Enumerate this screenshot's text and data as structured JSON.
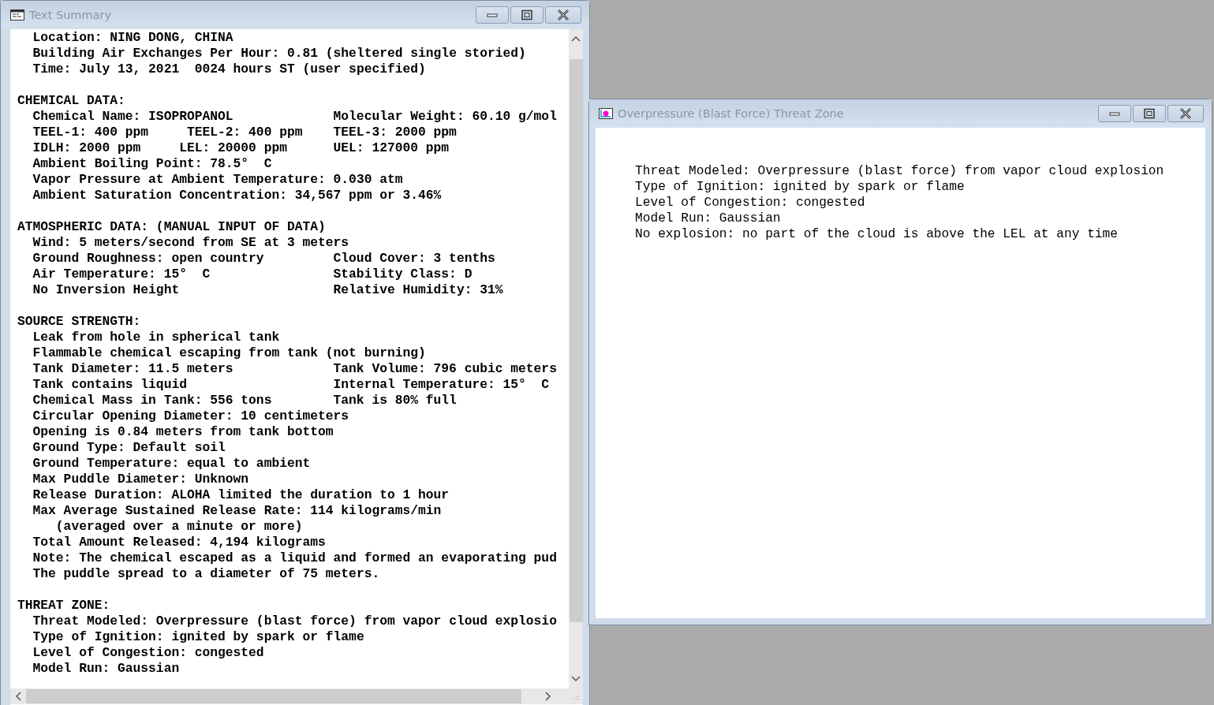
{
  "windows": [
    {
      "kind": "text_summary",
      "title": "Text Summary",
      "sections": [
        {
          "lines": [
            {
              "kind": "item",
              "text": "Location: NING DONG, CHINA"
            },
            {
              "kind": "item",
              "text": "Building Air Exchanges Per Hour: 0.81 (sheltered single storied)"
            },
            {
              "kind": "item",
              "text": "Time: July 13, 2021  0024 hours ST (user specified)"
            }
          ]
        },
        {
          "heading": "CHEMICAL DATA:",
          "lines": [
            {
              "kind": "item",
              "text": "Chemical Name: ISOPROPANOL",
              "column_2": "Molecular Weight: 60.10 g/mol"
            },
            {
              "kind": "item",
              "text": "TEEL-1: 400 ppm     TEEL-2: 400 ppm",
              "column_2": "TEEL-3: 2000 ppm"
            },
            {
              "kind": "item",
              "text": "IDLH: 2000 ppm     LEL: 20000 ppm",
              "column_2": "UEL: 127000 ppm"
            },
            {
              "kind": "item",
              "text": "Ambient Boiling Point: 78.5°  C"
            },
            {
              "kind": "item",
              "text": "Vapor Pressure at Ambient Temperature: 0.030 atm"
            },
            {
              "kind": "item",
              "text": "Ambient Saturation Concentration: 34,567 ppm or 3.46%"
            }
          ]
        },
        {
          "heading": "ATMOSPHERIC DATA: (MANUAL INPUT OF DATA)",
          "lines": [
            {
              "kind": "item",
              "text": "Wind: 5 meters/second from SE at 3 meters"
            },
            {
              "kind": "item",
              "text": "Ground Roughness: open country",
              "column_2": "Cloud Cover: 3 tenths"
            },
            {
              "kind": "item",
              "text": "Air Temperature: 15°  C",
              "column_2": "Stability Class: D"
            },
            {
              "kind": "item",
              "text": "No Inversion Height",
              "column_2": "Relative Humidity: 31%"
            }
          ]
        },
        {
          "heading": "SOURCE STRENGTH:",
          "lines": [
            {
              "kind": "item",
              "text": "Leak from hole in spherical tank"
            },
            {
              "kind": "item",
              "text": "Flammable chemical escaping from tank (not burning)"
            },
            {
              "kind": "item",
              "text": "Tank Diameter: 11.5 meters",
              "column_2": "Tank Volume: 796 cubic meters"
            },
            {
              "kind": "item",
              "text": "Tank contains liquid",
              "column_2": "Internal Temperature: 15°  C"
            },
            {
              "kind": "item",
              "text": "Chemical Mass in Tank: 556 tons",
              "column_2": "Tank is 80% full"
            },
            {
              "kind": "item",
              "text": "Circular Opening Diameter: 10 centimeters"
            },
            {
              "kind": "item",
              "text": "Opening is 0.84 meters from tank bottom"
            },
            {
              "kind": "item",
              "text": "Ground Type: Default soil"
            },
            {
              "kind": "item",
              "text": "Ground Temperature: equal to ambient"
            },
            {
              "kind": "item",
              "text": "Max Puddle Diameter: Unknown"
            },
            {
              "kind": "item",
              "text": "Release Duration: ALOHA limited the duration to 1 hour"
            },
            {
              "kind": "item",
              "text": "Max Average Sustained Release Rate: 114 kilograms/min"
            },
            {
              "kind": "continuation",
              "text": "(averaged over a minute or more)"
            },
            {
              "kind": "item",
              "text": "Total Amount Released: 4,194 kilograms"
            },
            {
              "kind": "item",
              "text": "Note: The chemical escaped as a liquid and formed an evaporating pud"
            },
            {
              "kind": "item",
              "text": "The puddle spread to a diameter of 75 meters."
            }
          ]
        },
        {
          "heading": "THREAT ZONE:",
          "lines": [
            {
              "kind": "item",
              "text": "Threat Modeled: Overpressure (blast force) from vapor cloud explosio"
            },
            {
              "kind": "item",
              "text": "Type of Ignition: ignited by spark or flame"
            },
            {
              "kind": "item",
              "text": "Level of Congestion: congested"
            },
            {
              "kind": "item",
              "text": "Model Run: Gaussian"
            }
          ]
        }
      ]
    },
    {
      "kind": "threat_zone",
      "title": "Overpressure (Blast Force) Threat Zone",
      "sections": [
        {
          "lines": [
            {
              "kind": "plain",
              "text": "Threat Modeled: Overpressure (blast force) from vapor cloud explosion"
            },
            {
              "kind": "plain",
              "text": "Type of Ignition: ignited by spark or flame"
            },
            {
              "kind": "plain",
              "text": "Level of Congestion: congested"
            },
            {
              "kind": "plain",
              "text": "Model Run: Gaussian"
            },
            {
              "kind": "plain",
              "text": "No explosion: no part of the cloud is above the LEL at any time"
            }
          ]
        }
      ]
    }
  ]
}
